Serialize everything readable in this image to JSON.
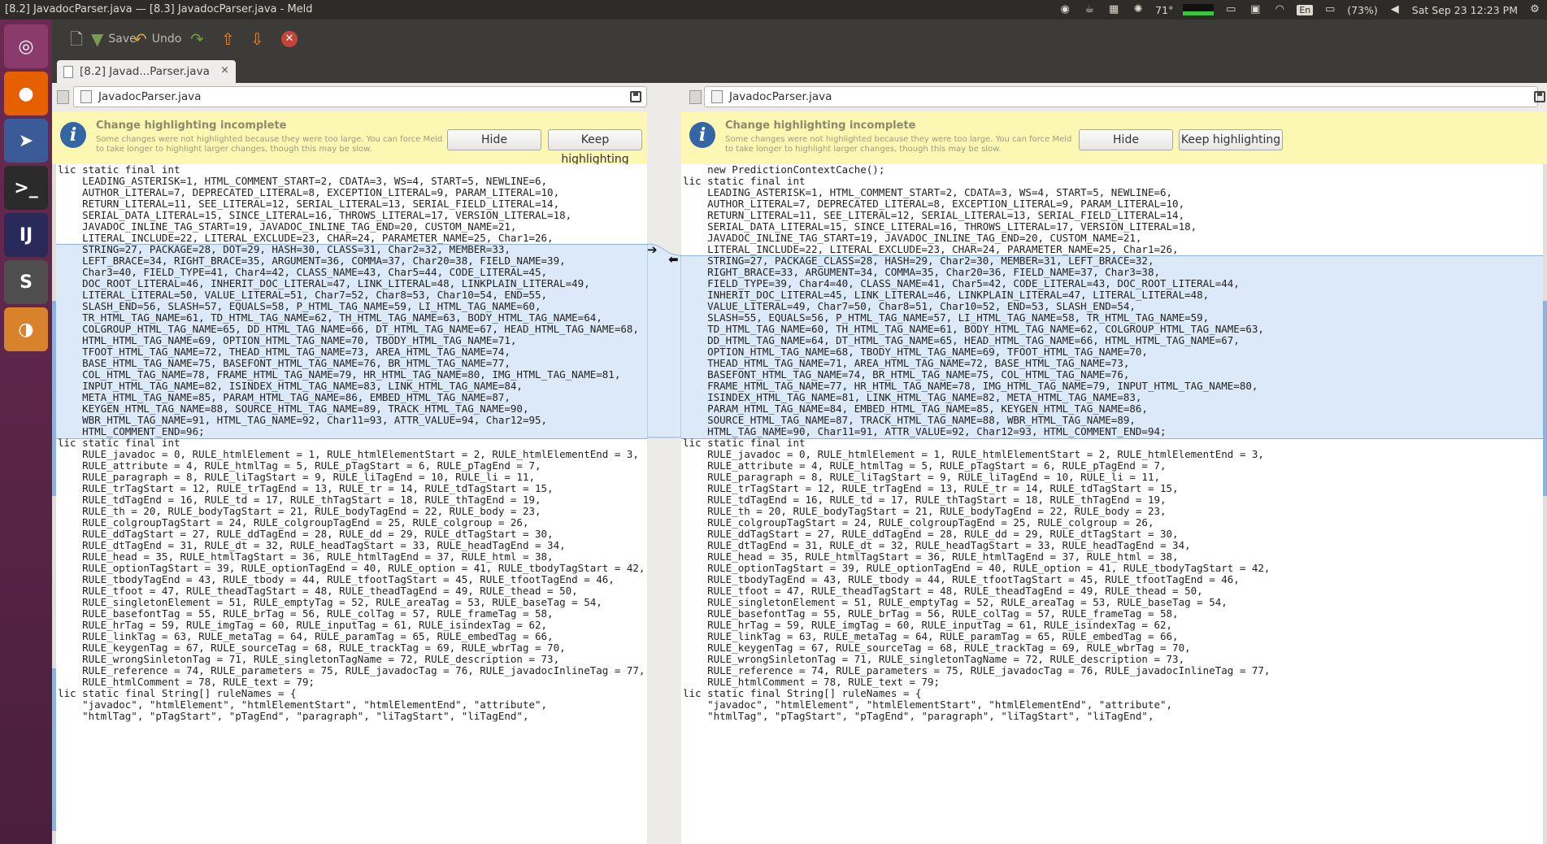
{
  "window": {
    "title": "[8.2] JavadocParser.java — [8.3] JavadocParser.java - Meld"
  },
  "tray": {
    "weather": "71°",
    "kbd": "En",
    "battery": "(73%)",
    "clock": "Sat Sep 23 12:23 PM"
  },
  "launcher": [
    {
      "name": "ubuntu-dash-icon",
      "color": "#8a3a6b",
      "glyph": "◎"
    },
    {
      "name": "firefox-icon",
      "color": "#e66000",
      "glyph": "●"
    },
    {
      "name": "meld-app-icon",
      "color": "#3b5b98",
      "glyph": "➤"
    },
    {
      "name": "terminal-icon",
      "color": "#2b2b2b",
      "glyph": ">_"
    },
    {
      "name": "intellij-icon",
      "color": "#2a2a5a",
      "glyph": "IJ"
    },
    {
      "name": "sublime-icon",
      "color": "#4e4e4e",
      "glyph": "S"
    },
    {
      "name": "blender-icon",
      "color": "#d8822b",
      "glyph": "◑"
    }
  ],
  "toolbar": {
    "save_label": "Save",
    "undo_label": "Undo"
  },
  "tab": {
    "label": "[8.2] Javad...Parser.java",
    "close": "×"
  },
  "left": {
    "filename": "JavadocParser.java"
  },
  "right": {
    "filename": "JavadocParser.java"
  },
  "infobar": {
    "title": "Change highlighting incomplete",
    "message": "Some changes were not highlighted because they were too large. You can force Meld to take longer to highlight larger changes, though this may be slow.",
    "hide_label": "Hide",
    "keep_label": "Keep highlighting"
  },
  "code_left": [
    "lic static final int",
    "    LEADING_ASTERISK=1, HTML_COMMENT_START=2, CDATA=3, WS=4, START=5, NEWLINE=6,",
    "    AUTHOR_LITERAL=7, DEPRECATED_LITERAL=8, EXCEPTION_LITERAL=9, PARAM_LITERAL=10,",
    "    RETURN_LITERAL=11, SEE_LITERAL=12, SERIAL_LITERAL=13, SERIAL_FIELD_LITERAL=14,",
    "    SERIAL_DATA_LITERAL=15, SINCE_LITERAL=16, THROWS_LITERAL=17, VERSION_LITERAL=18,",
    "    JAVADOC_INLINE_TAG_START=19, JAVADOC_INLINE_TAG_END=20, CUSTOM_NAME=21,",
    "    LITERAL_INCLUDE=22, LITERAL_EXCLUDE=23, CHAR=24, PARAMETER_NAME=25, Char1=26,",
    "    STRING=27, PACKAGE=28, DOT=29, HASH=30, CLASS=31, Char2=32, MEMBER=33,",
    "    LEFT_BRACE=34, RIGHT_BRACE=35, ARGUMENT=36, COMMA=37, Char20=38, FIELD_NAME=39,",
    "    Char3=40, FIELD_TYPE=41, Char4=42, CLASS_NAME=43, Char5=44, CODE_LITERAL=45,",
    "    DOC_ROOT_LITERAL=46, INHERIT_DOC_LITERAL=47, LINK_LITERAL=48, LINKPLAIN_LITERAL=49,",
    "    LITERAL_LITERAL=50, VALUE_LITERAL=51, Char7=52, Char8=53, Char10=54, END=55,",
    "    SLASH_END=56, SLASH=57, EQUALS=58, P_HTML_TAG_NAME=59, LI_HTML_TAG_NAME=60,",
    "    TR_HTML_TAG_NAME=61, TD_HTML_TAG_NAME=62, TH_HTML_TAG_NAME=63, BODY_HTML_TAG_NAME=64,",
    "    COLGROUP_HTML_TAG_NAME=65, DD_HTML_TAG_NAME=66, DT_HTML_TAG_NAME=67, HEAD_HTML_TAG_NAME=68,",
    "    HTML_HTML_TAG_NAME=69, OPTION_HTML_TAG_NAME=70, TBODY_HTML_TAG_NAME=71,",
    "    TFOOT_HTML_TAG_NAME=72, THEAD_HTML_TAG_NAME=73, AREA_HTML_TAG_NAME=74,",
    "    BASE_HTML_TAG_NAME=75, BASEFONT_HTML_TAG_NAME=76, BR_HTML_TAG_NAME=77,",
    "    COL_HTML_TAG_NAME=78, FRAME_HTML_TAG_NAME=79, HR_HTML_TAG_NAME=80, IMG_HTML_TAG_NAME=81,",
    "    INPUT_HTML_TAG_NAME=82, ISINDEX_HTML_TAG_NAME=83, LINK_HTML_TAG_NAME=84,",
    "    META_HTML_TAG_NAME=85, PARAM_HTML_TAG_NAME=86, EMBED_HTML_TAG_NAME=87,",
    "    KEYGEN_HTML_TAG_NAME=88, SOURCE_HTML_TAG_NAME=89, TRACK_HTML_TAG_NAME=90,",
    "    WBR_HTML_TAG_NAME=91, HTML_TAG_NAME=92, Char11=93, ATTR_VALUE=94, Char12=95,",
    "    HTML_COMMENT_END=96;",
    "lic static final int",
    "    RULE_javadoc = 0, RULE_htmlElement = 1, RULE_htmlElementStart = 2, RULE_htmlElementEnd = 3,",
    "    RULE_attribute = 4, RULE_htmlTag = 5, RULE_pTagStart = 6, RULE_pTagEnd = 7,",
    "    RULE_paragraph = 8, RULE_liTagStart = 9, RULE_liTagEnd = 10, RULE_li = 11,",
    "    RULE_trTagStart = 12, RULE_trTagEnd = 13, RULE_tr = 14, RULE_tdTagStart = 15,",
    "    RULE_tdTagEnd = 16, RULE_td = 17, RULE_thTagStart = 18, RULE_thTagEnd = 19,",
    "    RULE_th = 20, RULE_bodyTagStart = 21, RULE_bodyTagEnd = 22, RULE_body = 23,",
    "    RULE_colgroupTagStart = 24, RULE_colgroupTagEnd = 25, RULE_colgroup = 26,",
    "    RULE_ddTagStart = 27, RULE_ddTagEnd = 28, RULE_dd = 29, RULE_dtTagStart = 30,",
    "    RULE_dtTagEnd = 31, RULE_dt = 32, RULE_headTagStart = 33, RULE_headTagEnd = 34,",
    "    RULE_head = 35, RULE_htmlTagStart = 36, RULE_htmlTagEnd = 37, RULE_html = 38,",
    "    RULE_optionTagStart = 39, RULE_optionTagEnd = 40, RULE_option = 41, RULE_tbodyTagStart = 42,",
    "    RULE_tbodyTagEnd = 43, RULE_tbody = 44, RULE_tfootTagStart = 45, RULE_tfootTagEnd = 46,",
    "    RULE_tfoot = 47, RULE_theadTagStart = 48, RULE_theadTagEnd = 49, RULE_thead = 50,",
    "    RULE_singletonElement = 51, RULE_emptyTag = 52, RULE_areaTag = 53, RULE_baseTag = 54,",
    "    RULE_basefontTag = 55, RULE_brTag = 56, RULE_colTag = 57, RULE_frameTag = 58,",
    "    RULE_hrTag = 59, RULE_imgTag = 60, RULE_inputTag = 61, RULE_isindexTag = 62,",
    "    RULE_linkTag = 63, RULE_metaTag = 64, RULE_paramTag = 65, RULE_embedTag = 66,",
    "    RULE_keygenTag = 67, RULE_sourceTag = 68, RULE_trackTag = 69, RULE_wbrTag = 70,",
    "    RULE_wrongSinletonTag = 71, RULE_singletonTagName = 72, RULE_description = 73,",
    "    RULE_reference = 74, RULE_parameters = 75, RULE_javadocTag = 76, RULE_javadocInlineTag = 77,",
    "    RULE_htmlComment = 78, RULE_text = 79;",
    "lic static final String[] ruleNames = {",
    "    \"javadoc\", \"htmlElement\", \"htmlElementStart\", \"htmlElementEnd\", \"attribute\",",
    "    \"htmlTag\", \"pTagStart\", \"pTagEnd\", \"paragraph\", \"liTagStart\", \"liTagEnd\","
  ],
  "code_right": [
    "    new PredictionContextCache();",
    "lic static final int",
    "    LEADING_ASTERISK=1, HTML_COMMENT_START=2, CDATA=3, WS=4, START=5, NEWLINE=6,",
    "    AUTHOR_LITERAL=7, DEPRECATED_LITERAL=8, EXCEPTION_LITERAL=9, PARAM_LITERAL=10,",
    "    RETURN_LITERAL=11, SEE_LITERAL=12, SERIAL_LITERAL=13, SERIAL_FIELD_LITERAL=14,",
    "    SERIAL_DATA_LITERAL=15, SINCE_LITERAL=16, THROWS_LITERAL=17, VERSION_LITERAL=18,",
    "    JAVADOC_INLINE_TAG_START=19, JAVADOC_INLINE_TAG_END=20, CUSTOM_NAME=21,",
    "    LITERAL_INCLUDE=22, LITERAL_EXCLUDE=23, CHAR=24, PARAMETER_NAME=25, Char1=26,",
    "    STRING=27, PACKAGE_CLASS=28, HASH=29, Char2=30, MEMBER=31, LEFT_BRACE=32,",
    "    RIGHT_BRACE=33, ARGUMENT=34, COMMA=35, Char20=36, FIELD_NAME=37, Char3=38,",
    "    FIELD_TYPE=39, Char4=40, CLASS_NAME=41, Char5=42, CODE_LITERAL=43, DOC_ROOT_LITERAL=44,",
    "    INHERIT_DOC_LITERAL=45, LINK_LITERAL=46, LINKPLAIN_LITERAL=47, LITERAL_LITERAL=48,",
    "    VALUE_LITERAL=49, Char7=50, Char8=51, Char10=52, END=53, SLASH_END=54,",
    "    SLASH=55, EQUALS=56, P_HTML_TAG_NAME=57, LI_HTML_TAG_NAME=58, TR_HTML_TAG_NAME=59,",
    "    TD_HTML_TAG_NAME=60, TH_HTML_TAG_NAME=61, BODY_HTML_TAG_NAME=62, COLGROUP_HTML_TAG_NAME=63,",
    "    DD_HTML_TAG_NAME=64, DT_HTML_TAG_NAME=65, HEAD_HTML_TAG_NAME=66, HTML_HTML_TAG_NAME=67,",
    "    OPTION_HTML_TAG_NAME=68, TBODY_HTML_TAG_NAME=69, TFOOT_HTML_TAG_NAME=70,",
    "    THEAD_HTML_TAG_NAME=71, AREA_HTML_TAG_NAME=72, BASE_HTML_TAG_NAME=73,",
    "    BASEFONT_HTML_TAG_NAME=74, BR_HTML_TAG_NAME=75, COL_HTML_TAG_NAME=76,",
    "    FRAME_HTML_TAG_NAME=77, HR_HTML_TAG_NAME=78, IMG_HTML_TAG_NAME=79, INPUT_HTML_TAG_NAME=80,",
    "    ISINDEX_HTML_TAG_NAME=81, LINK_HTML_TAG_NAME=82, META_HTML_TAG_NAME=83,",
    "    PARAM_HTML_TAG_NAME=84, EMBED_HTML_TAG_NAME=85, KEYGEN_HTML_TAG_NAME=86,",
    "    SOURCE_HTML_TAG_NAME=87, TRACK_HTML_TAG_NAME=88, WBR_HTML_TAG_NAME=89,",
    "    HTML_TAG_NAME=90, Char11=91, ATTR_VALUE=92, Char12=93, HTML_COMMENT_END=94;",
    "lic static final int",
    "    RULE_javadoc = 0, RULE_htmlElement = 1, RULE_htmlElementStart = 2, RULE_htmlElementEnd = 3,",
    "    RULE_attribute = 4, RULE_htmlTag = 5, RULE_pTagStart = 6, RULE_pTagEnd = 7,",
    "    RULE_paragraph = 8, RULE_liTagStart = 9, RULE_liTagEnd = 10, RULE_li = 11,",
    "    RULE_trTagStart = 12, RULE_trTagEnd = 13, RULE_tr = 14, RULE_tdTagStart = 15,",
    "    RULE_tdTagEnd = 16, RULE_td = 17, RULE_thTagStart = 18, RULE_thTagEnd = 19,",
    "    RULE_th = 20, RULE_bodyTagStart = 21, RULE_bodyTagEnd = 22, RULE_body = 23,",
    "    RULE_colgroupTagStart = 24, RULE_colgroupTagEnd = 25, RULE_colgroup = 26,",
    "    RULE_ddTagStart = 27, RULE_ddTagEnd = 28, RULE_dd = 29, RULE_dtTagStart = 30,",
    "    RULE_dtTagEnd = 31, RULE_dt = 32, RULE_headTagStart = 33, RULE_headTagEnd = 34,",
    "    RULE_head = 35, RULE_htmlTagStart = 36, RULE_htmlTagEnd = 37, RULE_html = 38,",
    "    RULE_optionTagStart = 39, RULE_optionTagEnd = 40, RULE_option = 41, RULE_tbodyTagStart = 42,",
    "    RULE_tbodyTagEnd = 43, RULE_tbody = 44, RULE_tfootTagStart = 45, RULE_tfootTagEnd = 46,",
    "    RULE_tfoot = 47, RULE_theadTagStart = 48, RULE_theadTagEnd = 49, RULE_thead = 50,",
    "    RULE_singletonElement = 51, RULE_emptyTag = 52, RULE_areaTag = 53, RULE_baseTag = 54,",
    "    RULE_basefontTag = 55, RULE_brTag = 56, RULE_colTag = 57, RULE_frameTag = 58,",
    "    RULE_hrTag = 59, RULE_imgTag = 60, RULE_inputTag = 61, RULE_isindexTag = 62,",
    "    RULE_linkTag = 63, RULE_metaTag = 64, RULE_paramTag = 65, RULE_embedTag = 66,",
    "    RULE_keygenTag = 67, RULE_sourceTag = 68, RULE_trackTag = 69, RULE_wbrTag = 70,",
    "    RULE_wrongSinletonTag = 71, RULE_singletonTagName = 72, RULE_description = 73,",
    "    RULE_reference = 74, RULE_parameters = 75, RULE_javadocTag = 76, RULE_javadocInlineTag = 77,",
    "    RULE_htmlComment = 78, RULE_text = 79;",
    "lic static final String[] ruleNames = {",
    "    \"javadoc\", \"htmlElement\", \"htmlElementStart\", \"htmlElementEnd\", \"attribute\",",
    "    \"htmlTag\", \"pTagStart\", \"pTagEnd\", \"paragraph\", \"liTagStart\", \"liTagEnd\","
  ]
}
